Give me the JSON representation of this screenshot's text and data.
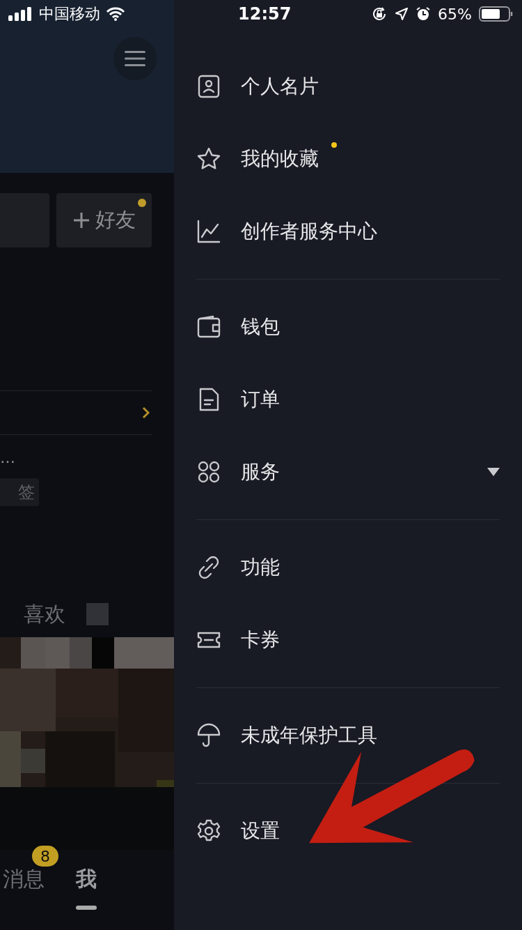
{
  "status_bar": {
    "carrier": "中国移动",
    "time": "12:57",
    "battery": "65%"
  },
  "profile": {
    "add_friend_button": {
      "label": "好友",
      "dot": true
    },
    "ellipsis": "…",
    "tag": "签",
    "tab": "喜欢"
  },
  "bottom_nav": [
    {
      "label": "消息",
      "badge": "8",
      "selected": false
    },
    {
      "label": "我",
      "selected": true
    }
  ],
  "drawer": {
    "groups": [
      [
        {
          "label": "个人名片",
          "kind": "card",
          "dot": false,
          "expandable": false
        },
        {
          "label": "我的收藏",
          "kind": "star",
          "dot": true,
          "expandable": false
        },
        {
          "label": "创作者服务中心",
          "kind": "chart",
          "dot": false,
          "expandable": false
        }
      ],
      [
        {
          "label": "钱包",
          "kind": "wallet",
          "dot": false,
          "expandable": false
        },
        {
          "label": "订单",
          "kind": "document",
          "dot": false,
          "expandable": false
        },
        {
          "label": "服务",
          "kind": "grid",
          "dot": false,
          "expandable": true
        }
      ],
      [
        {
          "label": "功能",
          "kind": "link",
          "dot": false,
          "expandable": false
        },
        {
          "label": "卡券",
          "kind": "ticket",
          "dot": false,
          "expandable": false
        }
      ],
      [
        {
          "label": "未成年保护工具",
          "kind": "umbrella",
          "dot": false,
          "expandable": false
        }
      ],
      [
        {
          "label": "设置",
          "kind": "gear",
          "dot": false,
          "expandable": false
        }
      ]
    ]
  }
}
